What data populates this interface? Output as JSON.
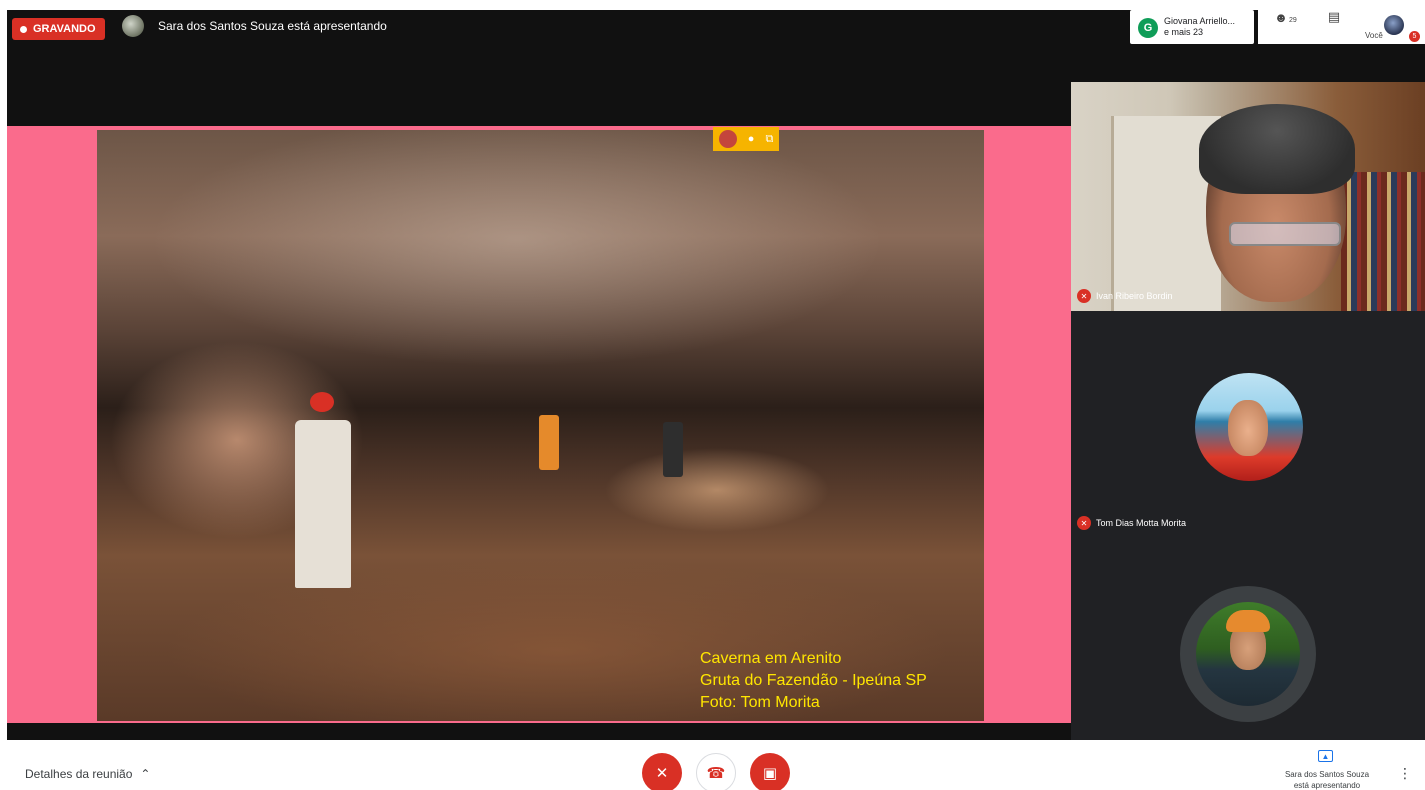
{
  "recording": {
    "label": "GRAVANDO"
  },
  "presenter": {
    "status": "Sara dos Santos Souza está apresentando"
  },
  "participants_chip": {
    "initial": "G",
    "name": "Giovana Arriello...",
    "more": "e mais 23"
  },
  "top_actions": {
    "people_count": "29",
    "you_label": "Você",
    "notification_count": "5"
  },
  "slide": {
    "caption_line1": "Caverna em Arenito",
    "caption_line2": "Gruta do Fazendão - Ipeúna SP",
    "caption_line3": "Foto: Tom Morita"
  },
  "tiles": [
    {
      "name": "Ivan Ribeiro Bordin"
    },
    {
      "name": "Tom Dias Motta Morita"
    }
  ],
  "bottom": {
    "details_label": "Detalhes da reunião",
    "presenting_line1": "Sara dos Santos Souza",
    "presenting_line2": "está apresentando"
  },
  "colors": {
    "stage_bg": "#fa6b8c",
    "rec_red": "#d93025",
    "caption": "#ffe600",
    "panel": "#202124"
  }
}
